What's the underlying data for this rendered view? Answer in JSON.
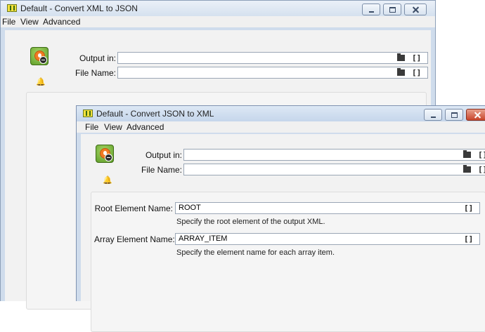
{
  "back_window": {
    "title": "Default - Convert XML to JSON",
    "menu": [
      "File",
      "View",
      "Advanced"
    ],
    "output_in_label": "Output in:",
    "output_in_value": "",
    "file_name_label": "File Name:",
    "file_name_value": ""
  },
  "front_window": {
    "title": "Default - Convert JSON to XML",
    "menu": [
      "File",
      "View",
      "Advanced"
    ],
    "output_in_label": "Output in:",
    "output_in_value": "",
    "file_name_label": "File Name:",
    "file_name_value": "",
    "root_element_label": "Root Element Name:",
    "root_element_value": "ROOT",
    "root_element_hint": "Specify the root element of the output XML.",
    "array_element_label": "Array Element Name:",
    "array_element_value": "ARRAY_ITEM",
    "array_element_hint": "Specify the element name for each array item."
  },
  "icons": {
    "app": "app-icon",
    "node": "convert-node-icon",
    "bell": "bell-icon",
    "folder": "folder-icon",
    "brackets": "brackets-icon",
    "minimize": "minimize-icon",
    "maximize": "maximize-icon",
    "close": "close-icon"
  },
  "colors": {
    "title_bar": "#d5e1ef",
    "close_active": "#c8452b",
    "node_orange": "#f07a22",
    "node_green": "#5b9a25"
  }
}
